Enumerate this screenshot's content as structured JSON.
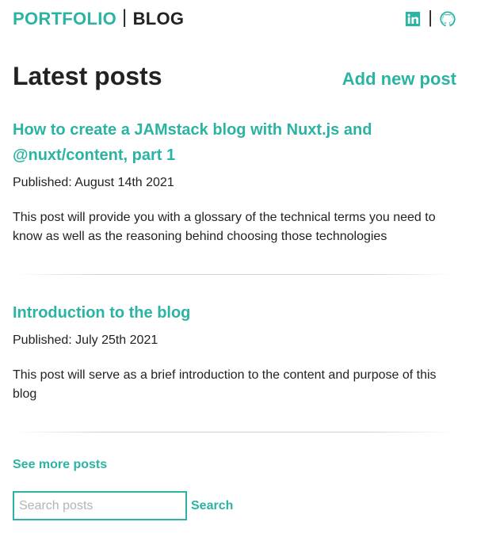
{
  "header": {
    "portfolio_label": "PORTFOLIO",
    "separator": "|",
    "blog_label": "BLOG",
    "social": [
      {
        "name": "linkedin",
        "icon": "linkedin-icon"
      },
      {
        "name": "github",
        "icon": "github-icon"
      }
    ],
    "social_separator": "|"
  },
  "main": {
    "title": "Latest posts",
    "add_post_label": "Add new post",
    "posts": [
      {
        "title": "How to create a JAMstack blog with Nuxt.js and @nuxt/content, part 1",
        "published": "Published: August 14th 2021",
        "summary": "This post will provide you with a glossary of the technical terms you need to know as well as the reasoning behind choosing those technologies"
      },
      {
        "title": "Introduction to the blog",
        "published": "Published: July 25th 2021",
        "summary": "This post will serve as a brief introduction to the content and purpose of this blog"
      }
    ],
    "see_more_label": "See more posts"
  },
  "search": {
    "placeholder": "Search posts",
    "value": "",
    "button_label": "Search"
  },
  "colors": {
    "accent": "#2bb3a3",
    "text": "#222222"
  }
}
